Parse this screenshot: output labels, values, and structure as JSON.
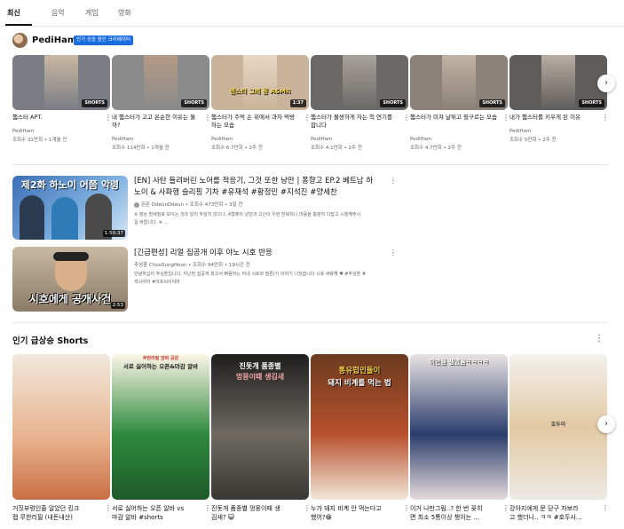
{
  "tabs": [
    "최신",
    "음악",
    "게임",
    "영화"
  ],
  "channel": {
    "name": "PediHam",
    "badge": "인기 상승 중인 크리에이터"
  },
  "shorts_row": [
    {
      "title": "햄스터 APT.",
      "channel": "PediHam",
      "meta": "조회수 31만회 • 1개월 전",
      "badge": "SHORTS"
    },
    {
      "title": "내 햄스터가 고고 온순한 이유는 뭘까?",
      "channel": "PediHam",
      "meta": "조회수 114만회 • 1개월 전",
      "badge": "SHORTS"
    },
    {
      "title": "햄스터가 주먹 손 위에서 과자 먹방하는 모습",
      "channel": "PediHam",
      "meta": "조회수 6.7만회 • 2주 전",
      "badge": "1:37",
      "overlay": "렌스터 그레 뭔 ASMR"
    },
    {
      "title": "햄스터가 불쌍하게 자는 척 연기를 합니다",
      "channel": "PediHam",
      "meta": "조회수 4.1만회 • 2주 전",
      "badge": "SHORTS"
    },
    {
      "title": "햄스터가 미쳐 날뛰고 뭥구르는 모습",
      "channel": "PediHam",
      "meta": "조회수 4.7만회 • 2주 전",
      "badge": "SHORTS"
    },
    {
      "title": "내가 햄스터를 키우게 된 이유",
      "channel": "PediHam",
      "meta": "조회수 5만회 • 2주 전",
      "badge": "SHORTS"
    }
  ],
  "long_videos": [
    {
      "title_line1": "[EN] 사탄 들려버린 노어를 적응기, 그것 또한 낭만 | 퐁향고 EP.2 베트남 하",
      "title_line2": "노이 & 사파행 슬리핑 기차 #유재석 #황정민 #지석진 #양세찬",
      "meta": "뜬뜬 DdeunDdeun • 조회수 473만회 • 3일 전",
      "desc_line1": "※ 영상 밤새질로 보이는 것과 달리 무심치 않으나, 4형제의 낭만과 고난이 우련 반복되니 마음을 충분히 다잡고 시청해주시",
      "desc_line2": "길 바랍니다. ※ ...",
      "duration": "1:50:37",
      "overlay": "제2화 하노이 어쯤 악령"
    },
    {
      "title_line1": "[긴급편성] 리얼 집공개 이후 야노 시호 반응",
      "meta": "추성훈 ChooSungHoon • 조회수 94만회 • 19시간 전",
      "desc_line1": "안녕하십끼 추성훈입니다. 지난번 집공개 최고서 빠람하는 아내 시호와 딸른(?) 이야기 나눴습니다 시호 싸랑해 ♥ #추성훈 #",
      "desc_line2": "섹시야마 #야프씨이야마",
      "duration": "2:53",
      "overlay": "시호에게 공개사건"
    }
  ],
  "trending": {
    "title": "인기 급상승 Shorts",
    "items": [
      {
        "title_line1": "거짓부렁인줄 알았던 킹크",
        "title_line2": "랩 무한리필 (내돈내산)"
      },
      {
        "title_line1": "서로 싫어하는 오픈 알바 vs",
        "title_line2": "마감 알바 #shorts",
        "overlay1": "서로 싫어하는 오픈&마감 알바",
        "overlay0": "무한리필 암바 공감"
      },
      {
        "title_line1": "진돗개 품종별 멍뭉이때 생",
        "title_line2": "김새? 😺",
        "overlay1": "진돗개 품종별",
        "overlay2": "멍뭉이때 생김새"
      },
      {
        "title_line1": "누가 돼지 비계 안 먹는다고",
        "title_line2": "했어?😁",
        "overlay1": "통유럽인들이",
        "overlay2": "돼지 비계를 먹는 법"
      },
      {
        "title_line1": "이거 나만그림..? 한 번 꽂히",
        "title_line2": "면 최소 5통이상 챙이는 ...",
        "overlay1": "이만큼 쟁였음ㅋㅋㅋㅋ"
      },
      {
        "title_line1": "강아지에게 문 닫구 자보라",
        "title_line2": "고 했더니.. ㅋㅋ #호두사...",
        "overlay1": "호두아"
      }
    ]
  },
  "icons": {
    "more": "more-vert-icon",
    "next": "chevron-right-icon"
  }
}
